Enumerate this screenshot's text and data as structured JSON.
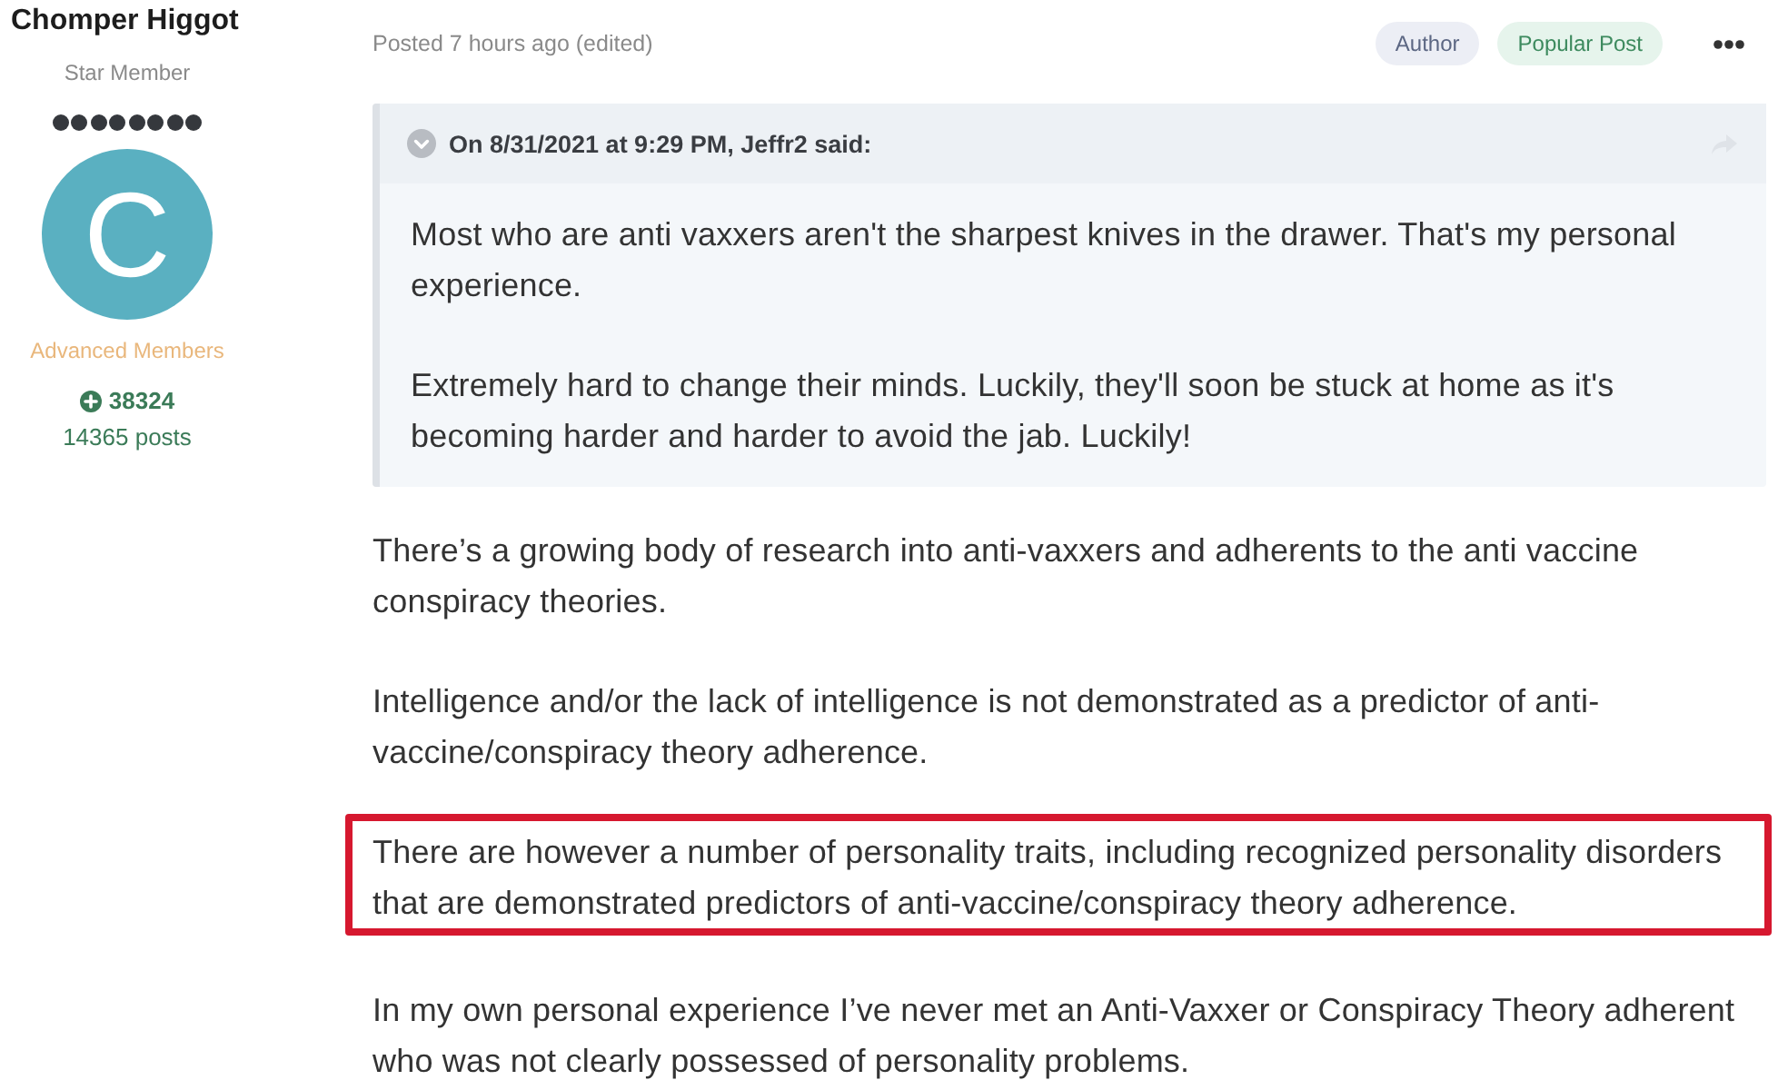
{
  "author": {
    "name": "Chomper Higgot",
    "rank": "Star Member",
    "stars": 8,
    "avatar_letter": "C",
    "group": "Advanced Members",
    "reputation": "38324",
    "posts": "14365 posts"
  },
  "post": {
    "meta": "Posted 7 hours ago (edited)",
    "badges": [
      {
        "label": "Author",
        "kind": "author"
      },
      {
        "label": "Popular Post",
        "kind": "popular"
      }
    ],
    "quote": {
      "citation": "On 8/31/2021 at 9:29 PM, Jeffr2 said:",
      "paragraphs": [
        "Most who are anti vaxxers aren't the sharpest knives in the drawer. That's my personal experience.",
        "Extremely hard to change their minds. Luckily, they'll soon be stuck at home as it's becoming harder and harder to avoid the jab. Luckily!"
      ]
    },
    "paragraphs": [
      {
        "text": "There’s a growing body of research into anti-vaxxers and adherents to the anti vaccine conspiracy theories.",
        "highlighted": false
      },
      {
        "text": "Intelligence and/or the lack of intelligence is not demonstrated as a predictor of anti-vaccine/conspiracy theory adherence.",
        "highlighted": false
      },
      {
        "text": "There are however a number of personality traits, including recognized personality disorders that are demonstrated predictors of anti-vaccine/conspiracy theory adherence.",
        "highlighted": true
      },
      {
        "text": "In my own personal experience I’ve never met an Anti-Vaxxer or Conspiracy Theory adherent who was not clearly possessed  of personality problems.",
        "highlighted": false
      }
    ]
  }
}
